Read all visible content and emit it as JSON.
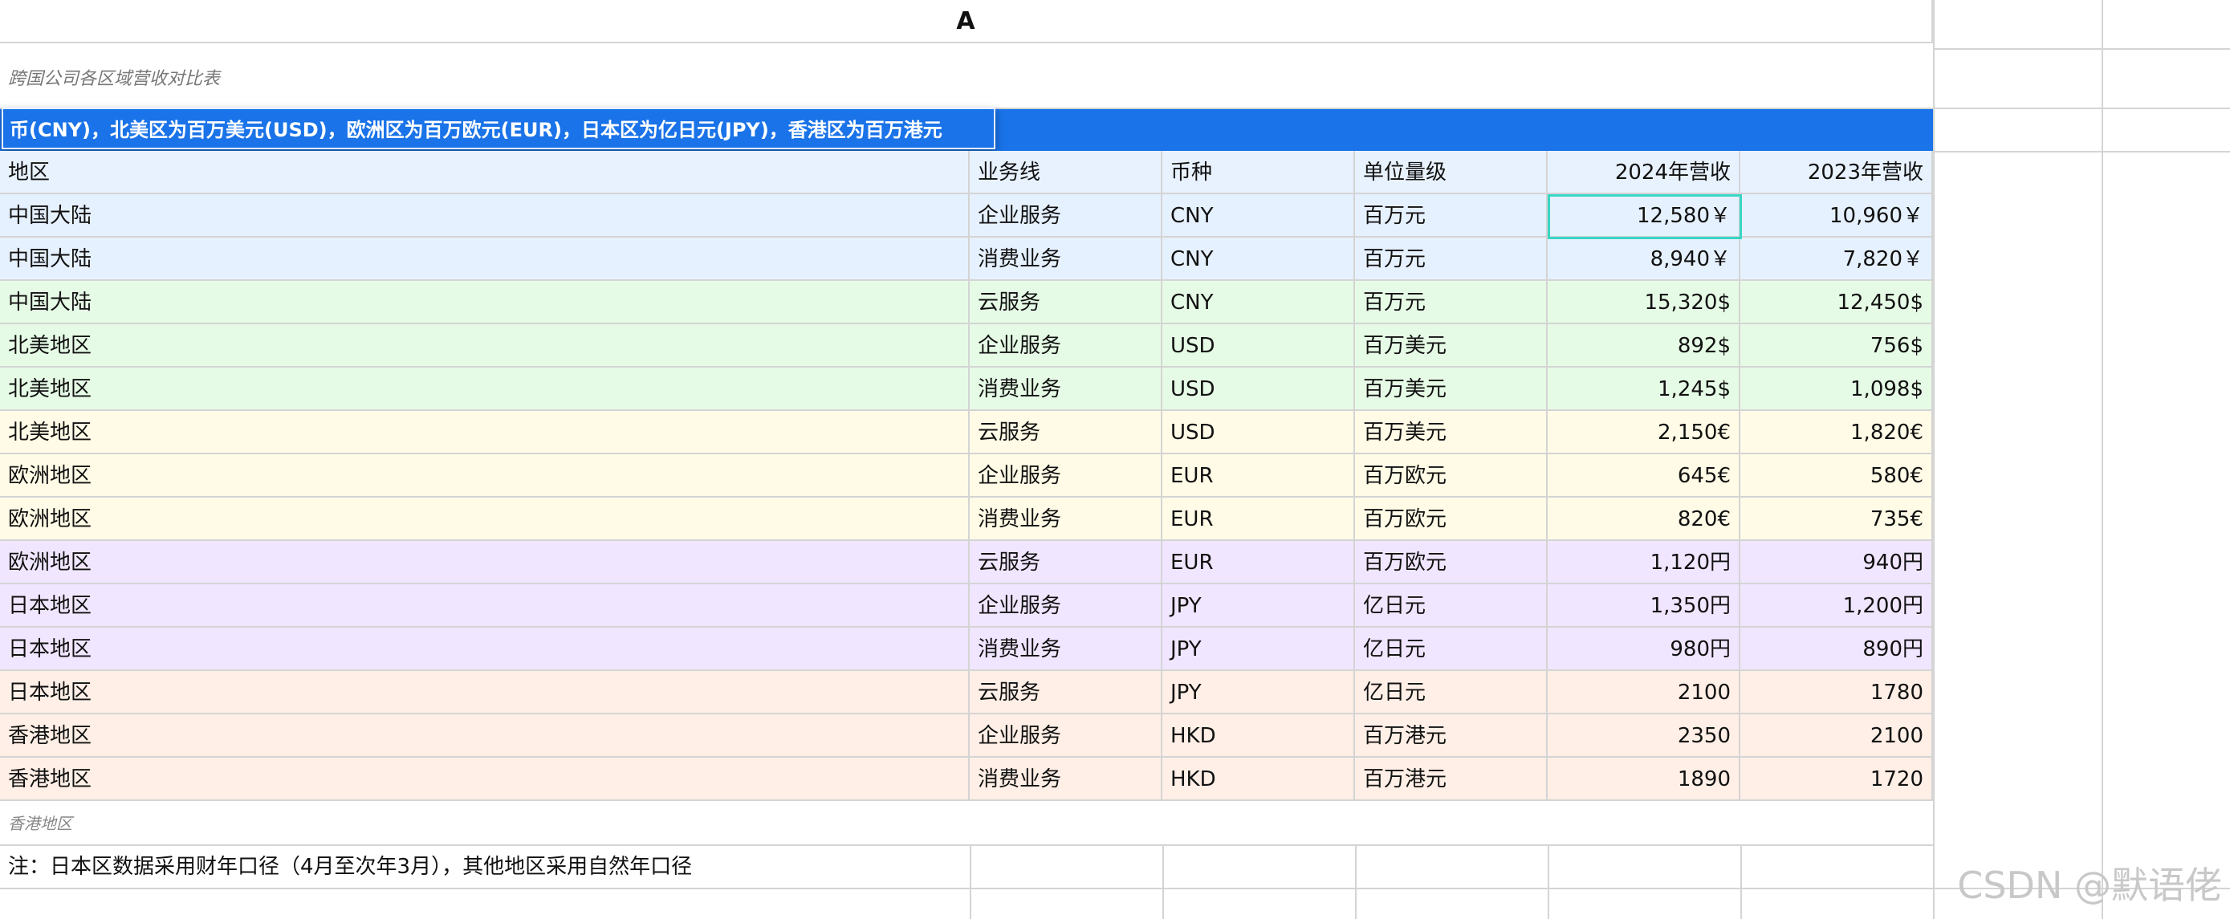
{
  "column_header": "A",
  "subtitle": "跨国公司各区域营收对比表",
  "unit_note": "币(CNY)，北美区为百万美元(USD)，欧洲区为百万欧元(EUR)，日本区为亿日元(JPY)，香港区为百万港元(HKD)",
  "table": {
    "headers": [
      "地区",
      "业务线",
      "币种",
      "单位量级",
      "2024年营收",
      "2023年营收"
    ],
    "rows": [
      {
        "region": "中国大陆",
        "line": "企业服务",
        "currency": "CNY",
        "unit": "百万元",
        "rev2024": "12,580￥",
        "rev2023": "10,960￥",
        "bg": "#e6f1ff"
      },
      {
        "region": "中国大陆",
        "line": "消费业务",
        "currency": "CNY",
        "unit": "百万元",
        "rev2024": "8,940￥",
        "rev2023": "7,820￥",
        "bg": "#e6f1ff"
      },
      {
        "region": "中国大陆",
        "line": "云服务",
        "currency": "CNY",
        "unit": "百万元",
        "rev2024": "15,320$",
        "rev2023": "12,450$",
        "bg": "#e6fbe6"
      },
      {
        "region": "北美地区",
        "line": "企业服务",
        "currency": "USD",
        "unit": "百万美元",
        "rev2024": "892$",
        "rev2023": "756$",
        "bg": "#e6fbe6"
      },
      {
        "region": "北美地区",
        "line": "消费业务",
        "currency": "USD",
        "unit": "百万美元",
        "rev2024": "1,245$",
        "rev2023": "1,098$",
        "bg": "#e6fbe6"
      },
      {
        "region": "北美地区",
        "line": "云服务",
        "currency": "USD",
        "unit": "百万美元",
        "rev2024": "2,150€",
        "rev2023": "1,820€",
        "bg": "#fffbe6"
      },
      {
        "region": "欧洲地区",
        "line": "企业服务",
        "currency": "EUR",
        "unit": "百万欧元",
        "rev2024": "645€",
        "rev2023": "580€",
        "bg": "#fffbe6"
      },
      {
        "region": "欧洲地区",
        "line": "消费业务",
        "currency": "EUR",
        "unit": "百万欧元",
        "rev2024": "820€",
        "rev2023": "735€",
        "bg": "#fffbe6"
      },
      {
        "region": "欧洲地区",
        "line": "云服务",
        "currency": "EUR",
        "unit": "百万欧元",
        "rev2024": "1,120円",
        "rev2023": "940円",
        "bg": "#f1e6ff"
      },
      {
        "region": "日本地区",
        "line": "企业服务",
        "currency": "JPY",
        "unit": "亿日元",
        "rev2024": "1,350円",
        "rev2023": "1,200円",
        "bg": "#f1e6ff"
      },
      {
        "region": "日本地区",
        "line": "消费业务",
        "currency": "JPY",
        "unit": "亿日元",
        "rev2024": "980円",
        "rev2023": "890円",
        "bg": "#f1e6ff"
      },
      {
        "region": "日本地区",
        "line": "云服务",
        "currency": "JPY",
        "unit": "亿日元",
        "rev2024": "2100",
        "rev2023": "1780",
        "bg": "#ffefe6"
      },
      {
        "region": "香港地区",
        "line": "企业服务",
        "currency": "HKD",
        "unit": "百万港元",
        "rev2024": "2350",
        "rev2023": "2100",
        "bg": "#ffefe6"
      },
      {
        "region": "香港地区",
        "line": "消费业务",
        "currency": "HKD",
        "unit": "百万港元",
        "rev2024": "1890",
        "rev2023": "1720",
        "bg": "#ffefe6"
      }
    ]
  },
  "footer_small": "香港地区",
  "note": "注：日本区数据采用财年口径（4月至次年3月），其他地区采用自然年口径",
  "watermark": "CSDN @默语佬",
  "colors": {
    "band": "#1a73e8",
    "header_bg": "#e8f2ff",
    "selection": "#38d6c4",
    "grid": "#d4d4d4"
  }
}
